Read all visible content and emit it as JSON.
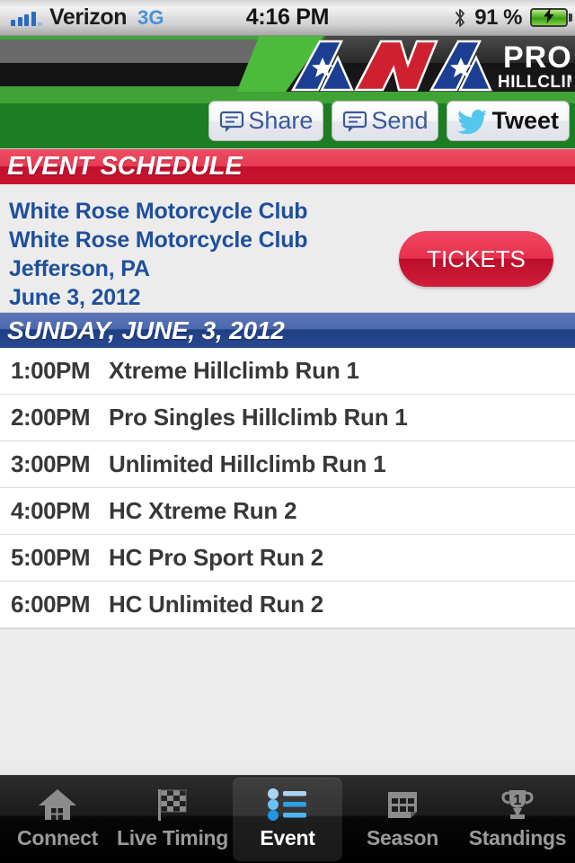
{
  "status_bar": {
    "signal_icon": "signal-bars-icon",
    "carrier": "Verizon",
    "network": "3G",
    "time": "4:16 PM",
    "bluetooth_icon": "bluetooth-icon",
    "battery_percent": "91 %",
    "battery_icon": "battery-charging-icon"
  },
  "header": {
    "logo_ama": "AMA",
    "logo_pro": "PRO",
    "logo_hillclimb": "HILLCLIMB",
    "share_buttons": [
      {
        "label": "Share",
        "icon": "speech-bubble-icon"
      },
      {
        "label": "Send",
        "icon": "speech-bubble-icon"
      },
      {
        "label": "Tweet",
        "icon": "twitter-bird-icon"
      }
    ]
  },
  "schedule_banner": {
    "title": "EVENT SCHEDULE"
  },
  "event_info": {
    "lines": [
      "White Rose Motorcycle Club",
      "White Rose Motorcycle Club",
      "Jefferson, PA",
      "June 3, 2012"
    ],
    "tickets_label": "TICKETS"
  },
  "day_banner": {
    "title": "SUNDAY, JUNE, 3, 2012"
  },
  "schedule": {
    "rows": [
      {
        "time": "1:00PM",
        "event": "Xtreme Hillclimb Run 1"
      },
      {
        "time": "2:00PM",
        "event": "Pro Singles Hillclimb Run 1"
      },
      {
        "time": "3:00PM",
        "event": "Unlimited Hillclimb Run 1"
      },
      {
        "time": "4:00PM",
        "event": "HC Xtreme Run 2"
      },
      {
        "time": "5:00PM",
        "event": "HC Pro Sport Run 2"
      },
      {
        "time": "6:00PM",
        "event": "HC Unlimited Run 2"
      }
    ]
  },
  "tab_bar": {
    "tabs": [
      {
        "label": "Connect",
        "icon": "home-icon",
        "active": false
      },
      {
        "label": "Live Timing",
        "icon": "checkered-flag-icon",
        "active": false
      },
      {
        "label": "Event",
        "icon": "bullet-list-icon",
        "active": true
      },
      {
        "label": "Season",
        "icon": "calendar-grid-icon",
        "active": false
      },
      {
        "label": "Standings",
        "icon": "trophy-icon",
        "active": false
      }
    ]
  },
  "colors": {
    "header_green": "#3fa335",
    "banner_red": "#c3102c",
    "banner_blue": "#1f3f85",
    "link_blue": "#1f4f9c",
    "tickets_red": "#e8304d",
    "page_gray": "#ececec",
    "accent_cyan": "#55c7ef"
  }
}
